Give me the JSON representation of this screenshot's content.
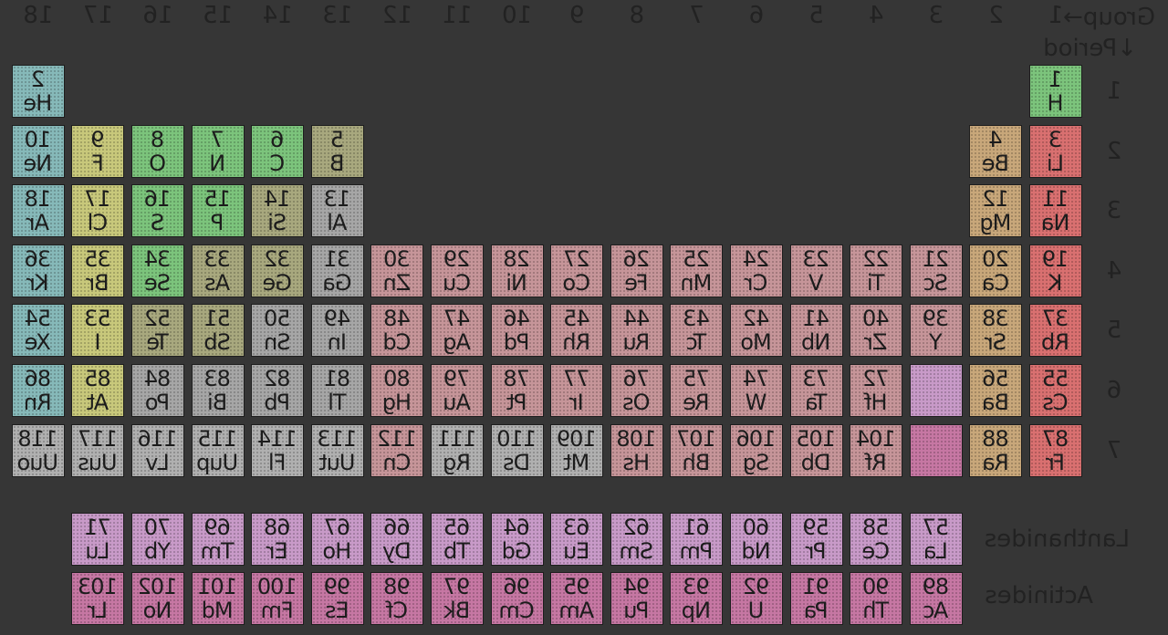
{
  "header": {
    "group_label": "Group→",
    "period_label": "↓Period"
  },
  "groups": [
    "1",
    "2",
    "3",
    "4",
    "5",
    "6",
    "7",
    "8",
    "9",
    "10",
    "11",
    "12",
    "13",
    "14",
    "15",
    "16",
    "17",
    "18"
  ],
  "periods": [
    "1",
    "2",
    "3",
    "4",
    "5",
    "6",
    "7"
  ],
  "series_labels": {
    "lanthanides": "Lanthanides",
    "actinides": "Actinides"
  },
  "colors": {
    "alkali": "#d97070",
    "alkaline": "#c8a77a",
    "transition": "#c69599",
    "lanthanide": "#c89ac8",
    "actinide": "#c677a3",
    "post_transition": "#a6a6a6",
    "metalloid": "#a8a87e",
    "nonmetal": "#7cc47c",
    "halogen": "#c8c87b",
    "noble": "#86b9b9",
    "unknown": "#b0b0b0"
  },
  "elements": [
    {
      "n": "1",
      "s": "H",
      "g": 1,
      "p": 1,
      "c": "nonmetal"
    },
    {
      "n": "2",
      "s": "He",
      "g": 18,
      "p": 1,
      "c": "noble"
    },
    {
      "n": "3",
      "s": "Li",
      "g": 1,
      "p": 2,
      "c": "alkali"
    },
    {
      "n": "4",
      "s": "Be",
      "g": 2,
      "p": 2,
      "c": "alkaline"
    },
    {
      "n": "5",
      "s": "B",
      "g": 13,
      "p": 2,
      "c": "metalloid"
    },
    {
      "n": "6",
      "s": "C",
      "g": 14,
      "p": 2,
      "c": "nonmetal"
    },
    {
      "n": "7",
      "s": "N",
      "g": 15,
      "p": 2,
      "c": "nonmetal"
    },
    {
      "n": "8",
      "s": "O",
      "g": 16,
      "p": 2,
      "c": "nonmetal"
    },
    {
      "n": "9",
      "s": "F",
      "g": 17,
      "p": 2,
      "c": "halogen"
    },
    {
      "n": "10",
      "s": "Ne",
      "g": 18,
      "p": 2,
      "c": "noble"
    },
    {
      "n": "11",
      "s": "Na",
      "g": 1,
      "p": 3,
      "c": "alkali"
    },
    {
      "n": "12",
      "s": "Mg",
      "g": 2,
      "p": 3,
      "c": "alkaline"
    },
    {
      "n": "13",
      "s": "Al",
      "g": 13,
      "p": 3,
      "c": "post_transition"
    },
    {
      "n": "14",
      "s": "Si",
      "g": 14,
      "p": 3,
      "c": "metalloid"
    },
    {
      "n": "15",
      "s": "P",
      "g": 15,
      "p": 3,
      "c": "nonmetal"
    },
    {
      "n": "16",
      "s": "S",
      "g": 16,
      "p": 3,
      "c": "nonmetal"
    },
    {
      "n": "17",
      "s": "Cl",
      "g": 17,
      "p": 3,
      "c": "halogen"
    },
    {
      "n": "18",
      "s": "Ar",
      "g": 18,
      "p": 3,
      "c": "noble"
    },
    {
      "n": "19",
      "s": "K",
      "g": 1,
      "p": 4,
      "c": "alkali"
    },
    {
      "n": "20",
      "s": "Ca",
      "g": 2,
      "p": 4,
      "c": "alkaline"
    },
    {
      "n": "21",
      "s": "Sc",
      "g": 3,
      "p": 4,
      "c": "transition"
    },
    {
      "n": "22",
      "s": "Ti",
      "g": 4,
      "p": 4,
      "c": "transition"
    },
    {
      "n": "23",
      "s": "V",
      "g": 5,
      "p": 4,
      "c": "transition"
    },
    {
      "n": "24",
      "s": "Cr",
      "g": 6,
      "p": 4,
      "c": "transition"
    },
    {
      "n": "25",
      "s": "Mn",
      "g": 7,
      "p": 4,
      "c": "transition"
    },
    {
      "n": "26",
      "s": "Fe",
      "g": 8,
      "p": 4,
      "c": "transition"
    },
    {
      "n": "27",
      "s": "Co",
      "g": 9,
      "p": 4,
      "c": "transition"
    },
    {
      "n": "28",
      "s": "Ni",
      "g": 10,
      "p": 4,
      "c": "transition"
    },
    {
      "n": "29",
      "s": "Cu",
      "g": 11,
      "p": 4,
      "c": "transition"
    },
    {
      "n": "30",
      "s": "Zn",
      "g": 12,
      "p": 4,
      "c": "transition"
    },
    {
      "n": "31",
      "s": "Ga",
      "g": 13,
      "p": 4,
      "c": "post_transition"
    },
    {
      "n": "32",
      "s": "Ge",
      "g": 14,
      "p": 4,
      "c": "metalloid"
    },
    {
      "n": "33",
      "s": "As",
      "g": 15,
      "p": 4,
      "c": "metalloid"
    },
    {
      "n": "34",
      "s": "Se",
      "g": 16,
      "p": 4,
      "c": "nonmetal"
    },
    {
      "n": "35",
      "s": "Br",
      "g": 17,
      "p": 4,
      "c": "halogen"
    },
    {
      "n": "36",
      "s": "Kr",
      "g": 18,
      "p": 4,
      "c": "noble"
    },
    {
      "n": "37",
      "s": "Rb",
      "g": 1,
      "p": 5,
      "c": "alkali"
    },
    {
      "n": "38",
      "s": "Sr",
      "g": 2,
      "p": 5,
      "c": "alkaline"
    },
    {
      "n": "39",
      "s": "Y",
      "g": 3,
      "p": 5,
      "c": "transition"
    },
    {
      "n": "40",
      "s": "Zr",
      "g": 4,
      "p": 5,
      "c": "transition"
    },
    {
      "n": "41",
      "s": "Nb",
      "g": 5,
      "p": 5,
      "c": "transition"
    },
    {
      "n": "42",
      "s": "Mo",
      "g": 6,
      "p": 5,
      "c": "transition"
    },
    {
      "n": "43",
      "s": "Tc",
      "g": 7,
      "p": 5,
      "c": "transition"
    },
    {
      "n": "44",
      "s": "Ru",
      "g": 8,
      "p": 5,
      "c": "transition"
    },
    {
      "n": "45",
      "s": "Rh",
      "g": 9,
      "p": 5,
      "c": "transition"
    },
    {
      "n": "46",
      "s": "Pd",
      "g": 10,
      "p": 5,
      "c": "transition"
    },
    {
      "n": "47",
      "s": "Ag",
      "g": 11,
      "p": 5,
      "c": "transition"
    },
    {
      "n": "48",
      "s": "Cd",
      "g": 12,
      "p": 5,
      "c": "transition"
    },
    {
      "n": "49",
      "s": "In",
      "g": 13,
      "p": 5,
      "c": "post_transition"
    },
    {
      "n": "50",
      "s": "Sn",
      "g": 14,
      "p": 5,
      "c": "post_transition"
    },
    {
      "n": "51",
      "s": "Sb",
      "g": 15,
      "p": 5,
      "c": "metalloid"
    },
    {
      "n": "52",
      "s": "Te",
      "g": 16,
      "p": 5,
      "c": "metalloid"
    },
    {
      "n": "53",
      "s": "I",
      "g": 17,
      "p": 5,
      "c": "halogen"
    },
    {
      "n": "54",
      "s": "Xe",
      "g": 18,
      "p": 5,
      "c": "noble"
    },
    {
      "n": "55",
      "s": "Cs",
      "g": 1,
      "p": 6,
      "c": "alkali"
    },
    {
      "n": "56",
      "s": "Ba",
      "g": 2,
      "p": 6,
      "c": "alkaline"
    },
    {
      "n": "",
      "s": "",
      "g": 3,
      "p": 6,
      "c": "lanthanide"
    },
    {
      "n": "72",
      "s": "Hf",
      "g": 4,
      "p": 6,
      "c": "transition"
    },
    {
      "n": "73",
      "s": "Ta",
      "g": 5,
      "p": 6,
      "c": "transition"
    },
    {
      "n": "74",
      "s": "W",
      "g": 6,
      "p": 6,
      "c": "transition"
    },
    {
      "n": "75",
      "s": "Re",
      "g": 7,
      "p": 6,
      "c": "transition"
    },
    {
      "n": "76",
      "s": "Os",
      "g": 8,
      "p": 6,
      "c": "transition"
    },
    {
      "n": "77",
      "s": "Ir",
      "g": 9,
      "p": 6,
      "c": "transition"
    },
    {
      "n": "78",
      "s": "Pt",
      "g": 10,
      "p": 6,
      "c": "transition"
    },
    {
      "n": "79",
      "s": "Au",
      "g": 11,
      "p": 6,
      "c": "transition"
    },
    {
      "n": "80",
      "s": "Hg",
      "g": 12,
      "p": 6,
      "c": "transition"
    },
    {
      "n": "81",
      "s": "Tl",
      "g": 13,
      "p": 6,
      "c": "post_transition"
    },
    {
      "n": "82",
      "s": "Pb",
      "g": 14,
      "p": 6,
      "c": "post_transition"
    },
    {
      "n": "83",
      "s": "Bi",
      "g": 15,
      "p": 6,
      "c": "post_transition"
    },
    {
      "n": "84",
      "s": "Po",
      "g": 16,
      "p": 6,
      "c": "post_transition"
    },
    {
      "n": "85",
      "s": "At",
      "g": 17,
      "p": 6,
      "c": "halogen"
    },
    {
      "n": "86",
      "s": "Rn",
      "g": 18,
      "p": 6,
      "c": "noble"
    },
    {
      "n": "87",
      "s": "Fr",
      "g": 1,
      "p": 7,
      "c": "alkali"
    },
    {
      "n": "88",
      "s": "Ra",
      "g": 2,
      "p": 7,
      "c": "alkaline"
    },
    {
      "n": "",
      "s": "",
      "g": 3,
      "p": 7,
      "c": "actinide"
    },
    {
      "n": "104",
      "s": "Rf",
      "g": 4,
      "p": 7,
      "c": "transition"
    },
    {
      "n": "105",
      "s": "Db",
      "g": 5,
      "p": 7,
      "c": "transition"
    },
    {
      "n": "106",
      "s": "Sg",
      "g": 6,
      "p": 7,
      "c": "transition"
    },
    {
      "n": "107",
      "s": "Bh",
      "g": 7,
      "p": 7,
      "c": "transition"
    },
    {
      "n": "108",
      "s": "Hs",
      "g": 8,
      "p": 7,
      "c": "transition"
    },
    {
      "n": "109",
      "s": "Mt",
      "g": 9,
      "p": 7,
      "c": "unknown"
    },
    {
      "n": "110",
      "s": "Ds",
      "g": 10,
      "p": 7,
      "c": "unknown"
    },
    {
      "n": "111",
      "s": "Rg",
      "g": 11,
      "p": 7,
      "c": "unknown"
    },
    {
      "n": "112",
      "s": "Cn",
      "g": 12,
      "p": 7,
      "c": "transition"
    },
    {
      "n": "113",
      "s": "Uut",
      "g": 13,
      "p": 7,
      "c": "unknown"
    },
    {
      "n": "114",
      "s": "Fl",
      "g": 14,
      "p": 7,
      "c": "unknown"
    },
    {
      "n": "115",
      "s": "Uup",
      "g": 15,
      "p": 7,
      "c": "unknown"
    },
    {
      "n": "116",
      "s": "Lv",
      "g": 16,
      "p": 7,
      "c": "unknown"
    },
    {
      "n": "117",
      "s": "Uus",
      "g": 17,
      "p": 7,
      "c": "unknown"
    },
    {
      "n": "118",
      "s": "Uuo",
      "g": 18,
      "p": 7,
      "c": "unknown"
    }
  ],
  "lanthanides": [
    {
      "n": "57",
      "s": "La"
    },
    {
      "n": "58",
      "s": "Ce"
    },
    {
      "n": "59",
      "s": "Pr"
    },
    {
      "n": "60",
      "s": "Nd"
    },
    {
      "n": "61",
      "s": "Pm"
    },
    {
      "n": "62",
      "s": "Sm"
    },
    {
      "n": "63",
      "s": "Eu"
    },
    {
      "n": "64",
      "s": "Gd"
    },
    {
      "n": "65",
      "s": "Tb"
    },
    {
      "n": "66",
      "s": "Dy"
    },
    {
      "n": "67",
      "s": "Ho"
    },
    {
      "n": "68",
      "s": "Er"
    },
    {
      "n": "69",
      "s": "Tm"
    },
    {
      "n": "70",
      "s": "Yb"
    },
    {
      "n": "71",
      "s": "Lu"
    }
  ],
  "actinides": [
    {
      "n": "89",
      "s": "Ac"
    },
    {
      "n": "90",
      "s": "Th"
    },
    {
      "n": "91",
      "s": "Pa"
    },
    {
      "n": "92",
      "s": "U"
    },
    {
      "n": "93",
      "s": "Np"
    },
    {
      "n": "94",
      "s": "Pu"
    },
    {
      "n": "95",
      "s": "Am"
    },
    {
      "n": "96",
      "s": "Cm"
    },
    {
      "n": "97",
      "s": "Bk"
    },
    {
      "n": "98",
      "s": "Cf"
    },
    {
      "n": "99",
      "s": "Es"
    },
    {
      "n": "100",
      "s": "Fm"
    },
    {
      "n": "101",
      "s": "Md"
    },
    {
      "n": "102",
      "s": "No"
    },
    {
      "n": "103",
      "s": "Lr"
    }
  ]
}
